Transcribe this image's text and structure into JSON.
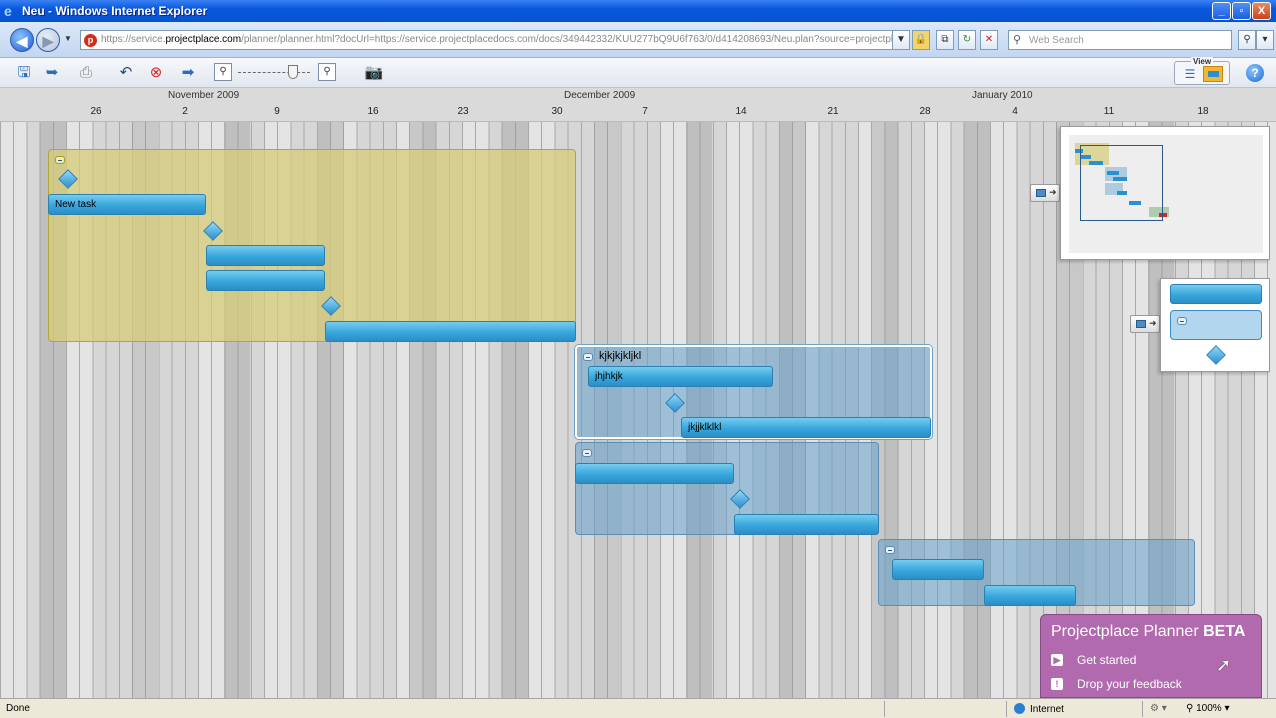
{
  "window": {
    "title": "Neu - Windows Internet Explorer",
    "min": "_",
    "max": "▫",
    "close": "X"
  },
  "address": {
    "url_prefix": "https://service.",
    "url_domain": "projectplace.com",
    "url_rest": "/planner/planner.html?docUrl=https://service.projectplacedocs.com/docs/349442332/KUU277bQ9U6f763/0/d414208693/Neu.plan?source=projectplace&",
    "search_placeholder": "Web Search"
  },
  "timeline": {
    "months": [
      "November 2009",
      "December 2009",
      "January 2010"
    ],
    "days": [
      "26",
      "2",
      "9",
      "16",
      "23",
      "30",
      "7",
      "14",
      "21",
      "28",
      "4",
      "11",
      "18"
    ]
  },
  "gantt": {
    "tasks": {
      "new_task": "New task",
      "group2_label": "kjkjkjkljkl",
      "g2_task1": "jhjhkjk",
      "g2_task2": "jkjjklklkl"
    }
  },
  "view": {
    "label": "View"
  },
  "beta": {
    "title": "Projectplace Planner ",
    "title_strong": "BETA",
    "get_started": "Get started",
    "feedback": "Drop your feedback"
  },
  "status": {
    "done": "Done",
    "zone": "Internet",
    "zoom": "100%"
  }
}
